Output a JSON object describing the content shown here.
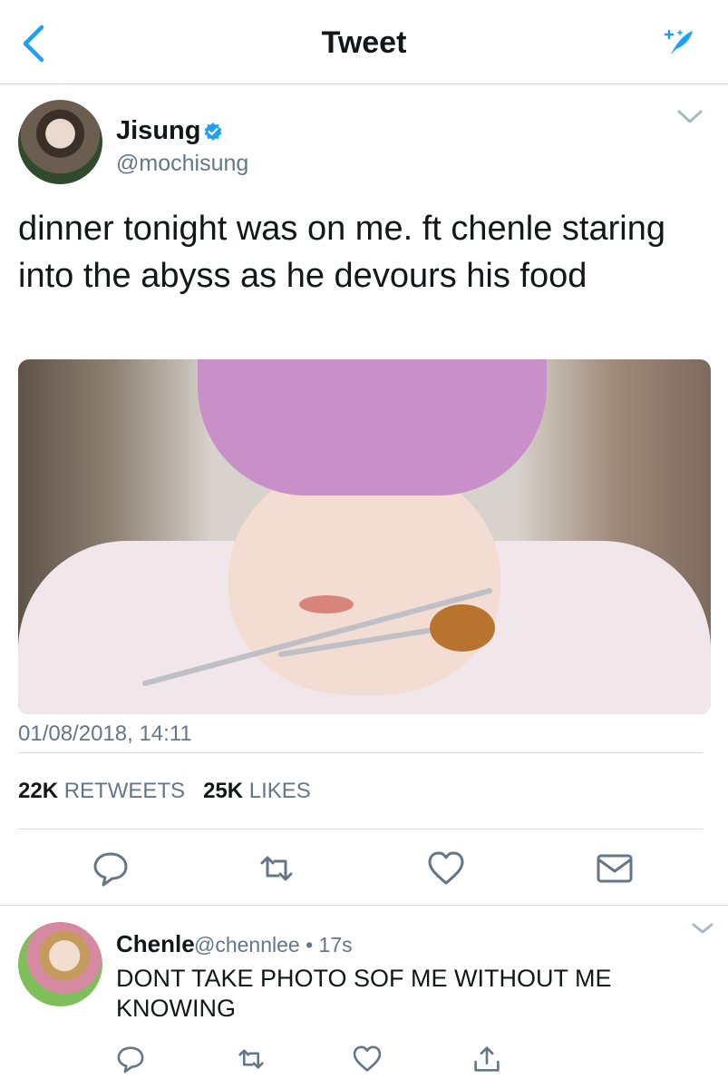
{
  "header": {
    "title": "Tweet",
    "back_icon": "chevron-left-icon",
    "compose_icon": "sparkle-feather-icon"
  },
  "tweet": {
    "display_name": "Jisung",
    "handle": "@mochisung",
    "text": "dinner tonight was on me. ft chenle staring into the abyss as he devours his food",
    "timestamp": "01/08/2018, 14:11",
    "retweets_count": "22K",
    "retweets_label": "RETWEETS",
    "likes_count": "25K",
    "likes_label": "LIKES"
  },
  "reply": {
    "display_name": "Chenle",
    "meta": "@chennlee • 17s",
    "text": "DONT TAKE PHOTO SOF ME WITHOUT ME KNOWING"
  },
  "colors": {
    "accent": "#1da1f2",
    "muted": "#657786",
    "text": "#14171a"
  }
}
